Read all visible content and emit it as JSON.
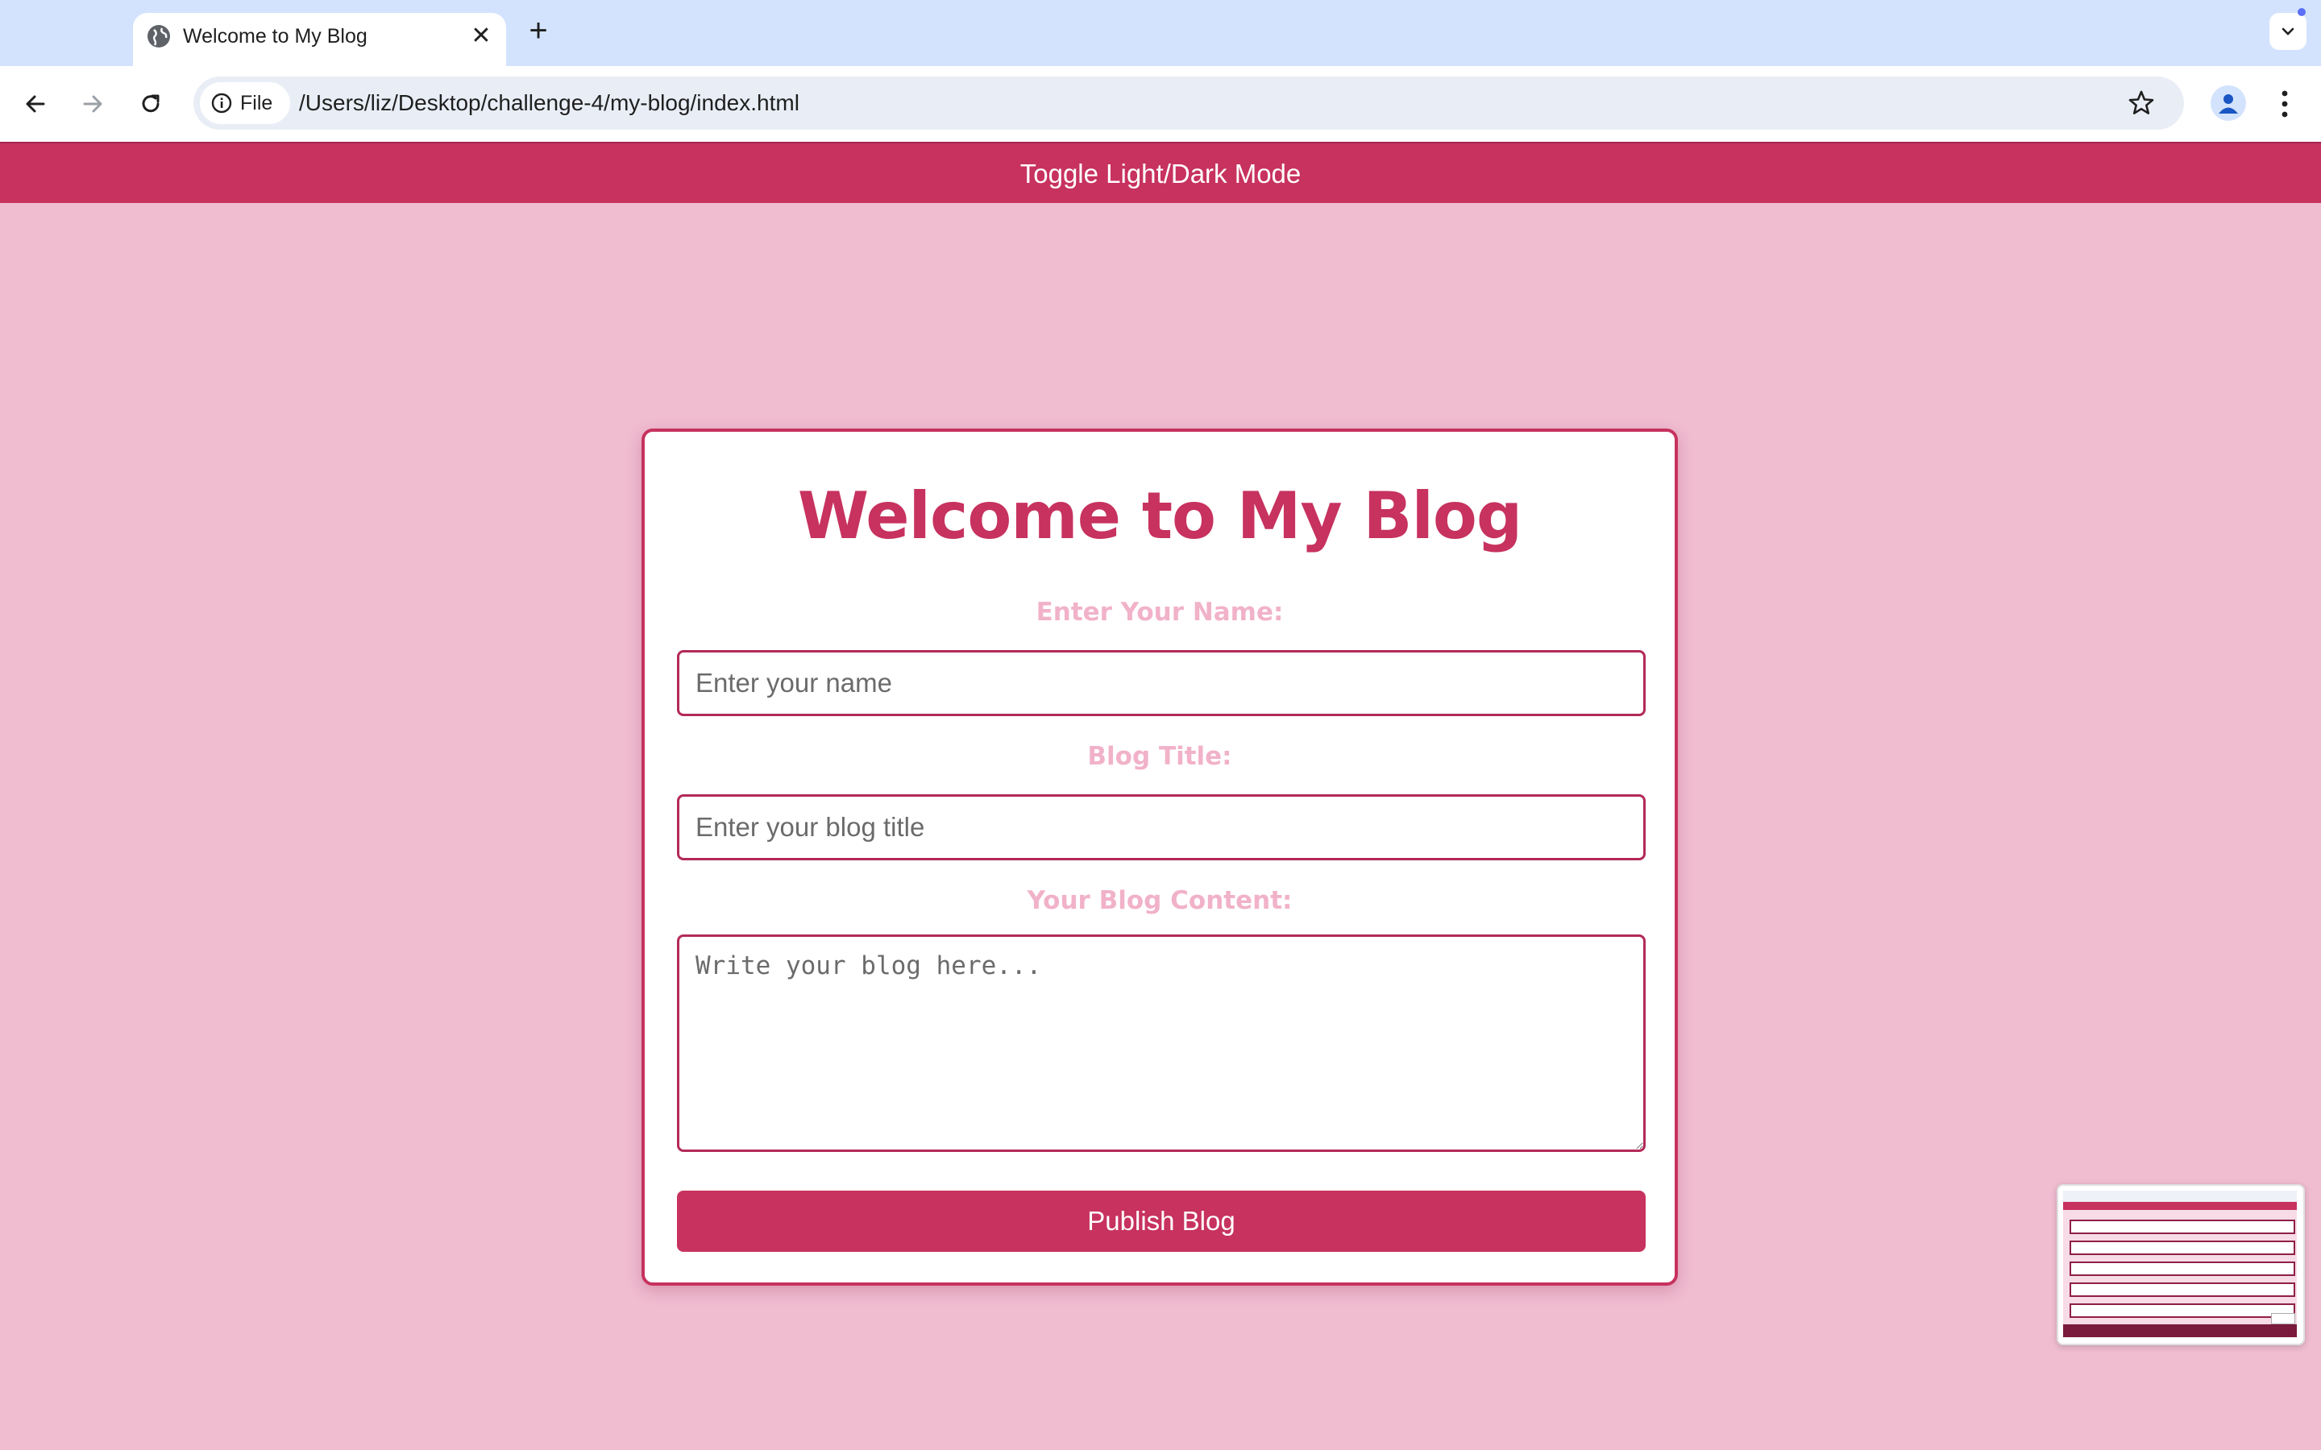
{
  "browser": {
    "tab": {
      "title": "Welcome to My Blog",
      "close_label": "✕"
    },
    "new_tab_label": "+",
    "address_bar": {
      "scheme_chip": "File",
      "url": "/Users/liz/Desktop/challenge-4/my-blog/index.html"
    }
  },
  "page": {
    "toggle_label": "Toggle Light/Dark Mode",
    "title": "Welcome to My Blog",
    "form": {
      "name_label": "Enter Your Name:",
      "name_placeholder": "Enter your name",
      "name_value": "",
      "title_label": "Blog Title:",
      "title_placeholder": "Enter your blog title",
      "title_value": "",
      "content_label": "Your Blog Content:",
      "content_placeholder": "Write your blog here...",
      "content_value": "",
      "submit_label": "Publish Blog"
    }
  },
  "colors": {
    "accent": "#c7325f",
    "page_background": "#efbcd0",
    "label_pink": "#f1b2c9",
    "tabstrip": "#d3e3fd"
  },
  "icons": [
    "globe-icon",
    "close-icon",
    "plus-icon",
    "chevron-down-icon",
    "back-arrow-icon",
    "forward-arrow-icon",
    "reload-icon",
    "info-icon",
    "star-icon",
    "profile-icon",
    "kebab-menu-icon"
  ]
}
